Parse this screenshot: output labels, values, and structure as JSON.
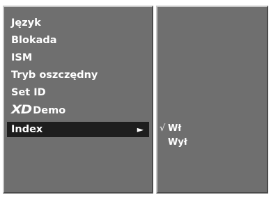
{
  "menu": {
    "items": [
      {
        "label": "Język"
      },
      {
        "label": "Blokada"
      },
      {
        "label": "ISM"
      },
      {
        "label": "Tryb oszczędny"
      },
      {
        "label": "Set ID"
      },
      {
        "logo": "XD",
        "label": "Demo"
      },
      {
        "label": "Index",
        "arrow": "►"
      }
    ]
  },
  "submenu": {
    "check": "√",
    "options": [
      {
        "label": "Wł",
        "checked": true
      },
      {
        "label": "Wył",
        "checked": false
      }
    ]
  }
}
